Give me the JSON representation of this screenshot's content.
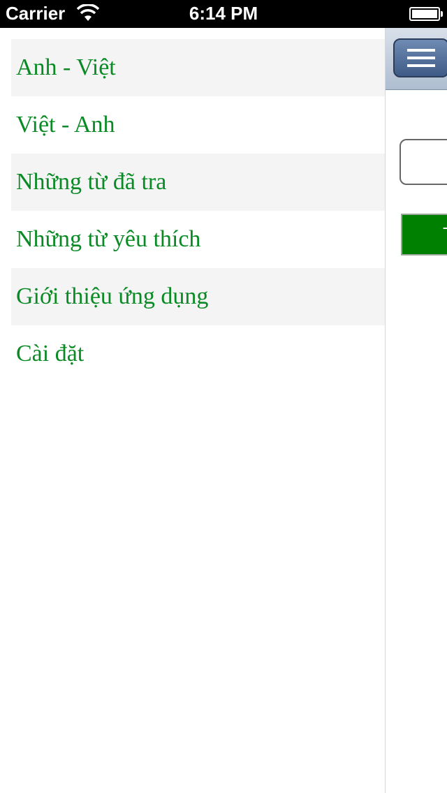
{
  "status_bar": {
    "carrier": "Carrier",
    "time": "6:14 PM"
  },
  "menu": {
    "items": [
      {
        "label": "Anh - Việt"
      },
      {
        "label": "Việt - Anh"
      },
      {
        "label": "Những từ đã tra"
      },
      {
        "label": "Những từ yêu thích"
      },
      {
        "label": "Giới thiệu ứng dụng"
      },
      {
        "label": "Cài đặt"
      }
    ],
    "text_color": "#0a8a25"
  },
  "main": {
    "button_label_fragment": "T",
    "button_color": "#008000"
  }
}
